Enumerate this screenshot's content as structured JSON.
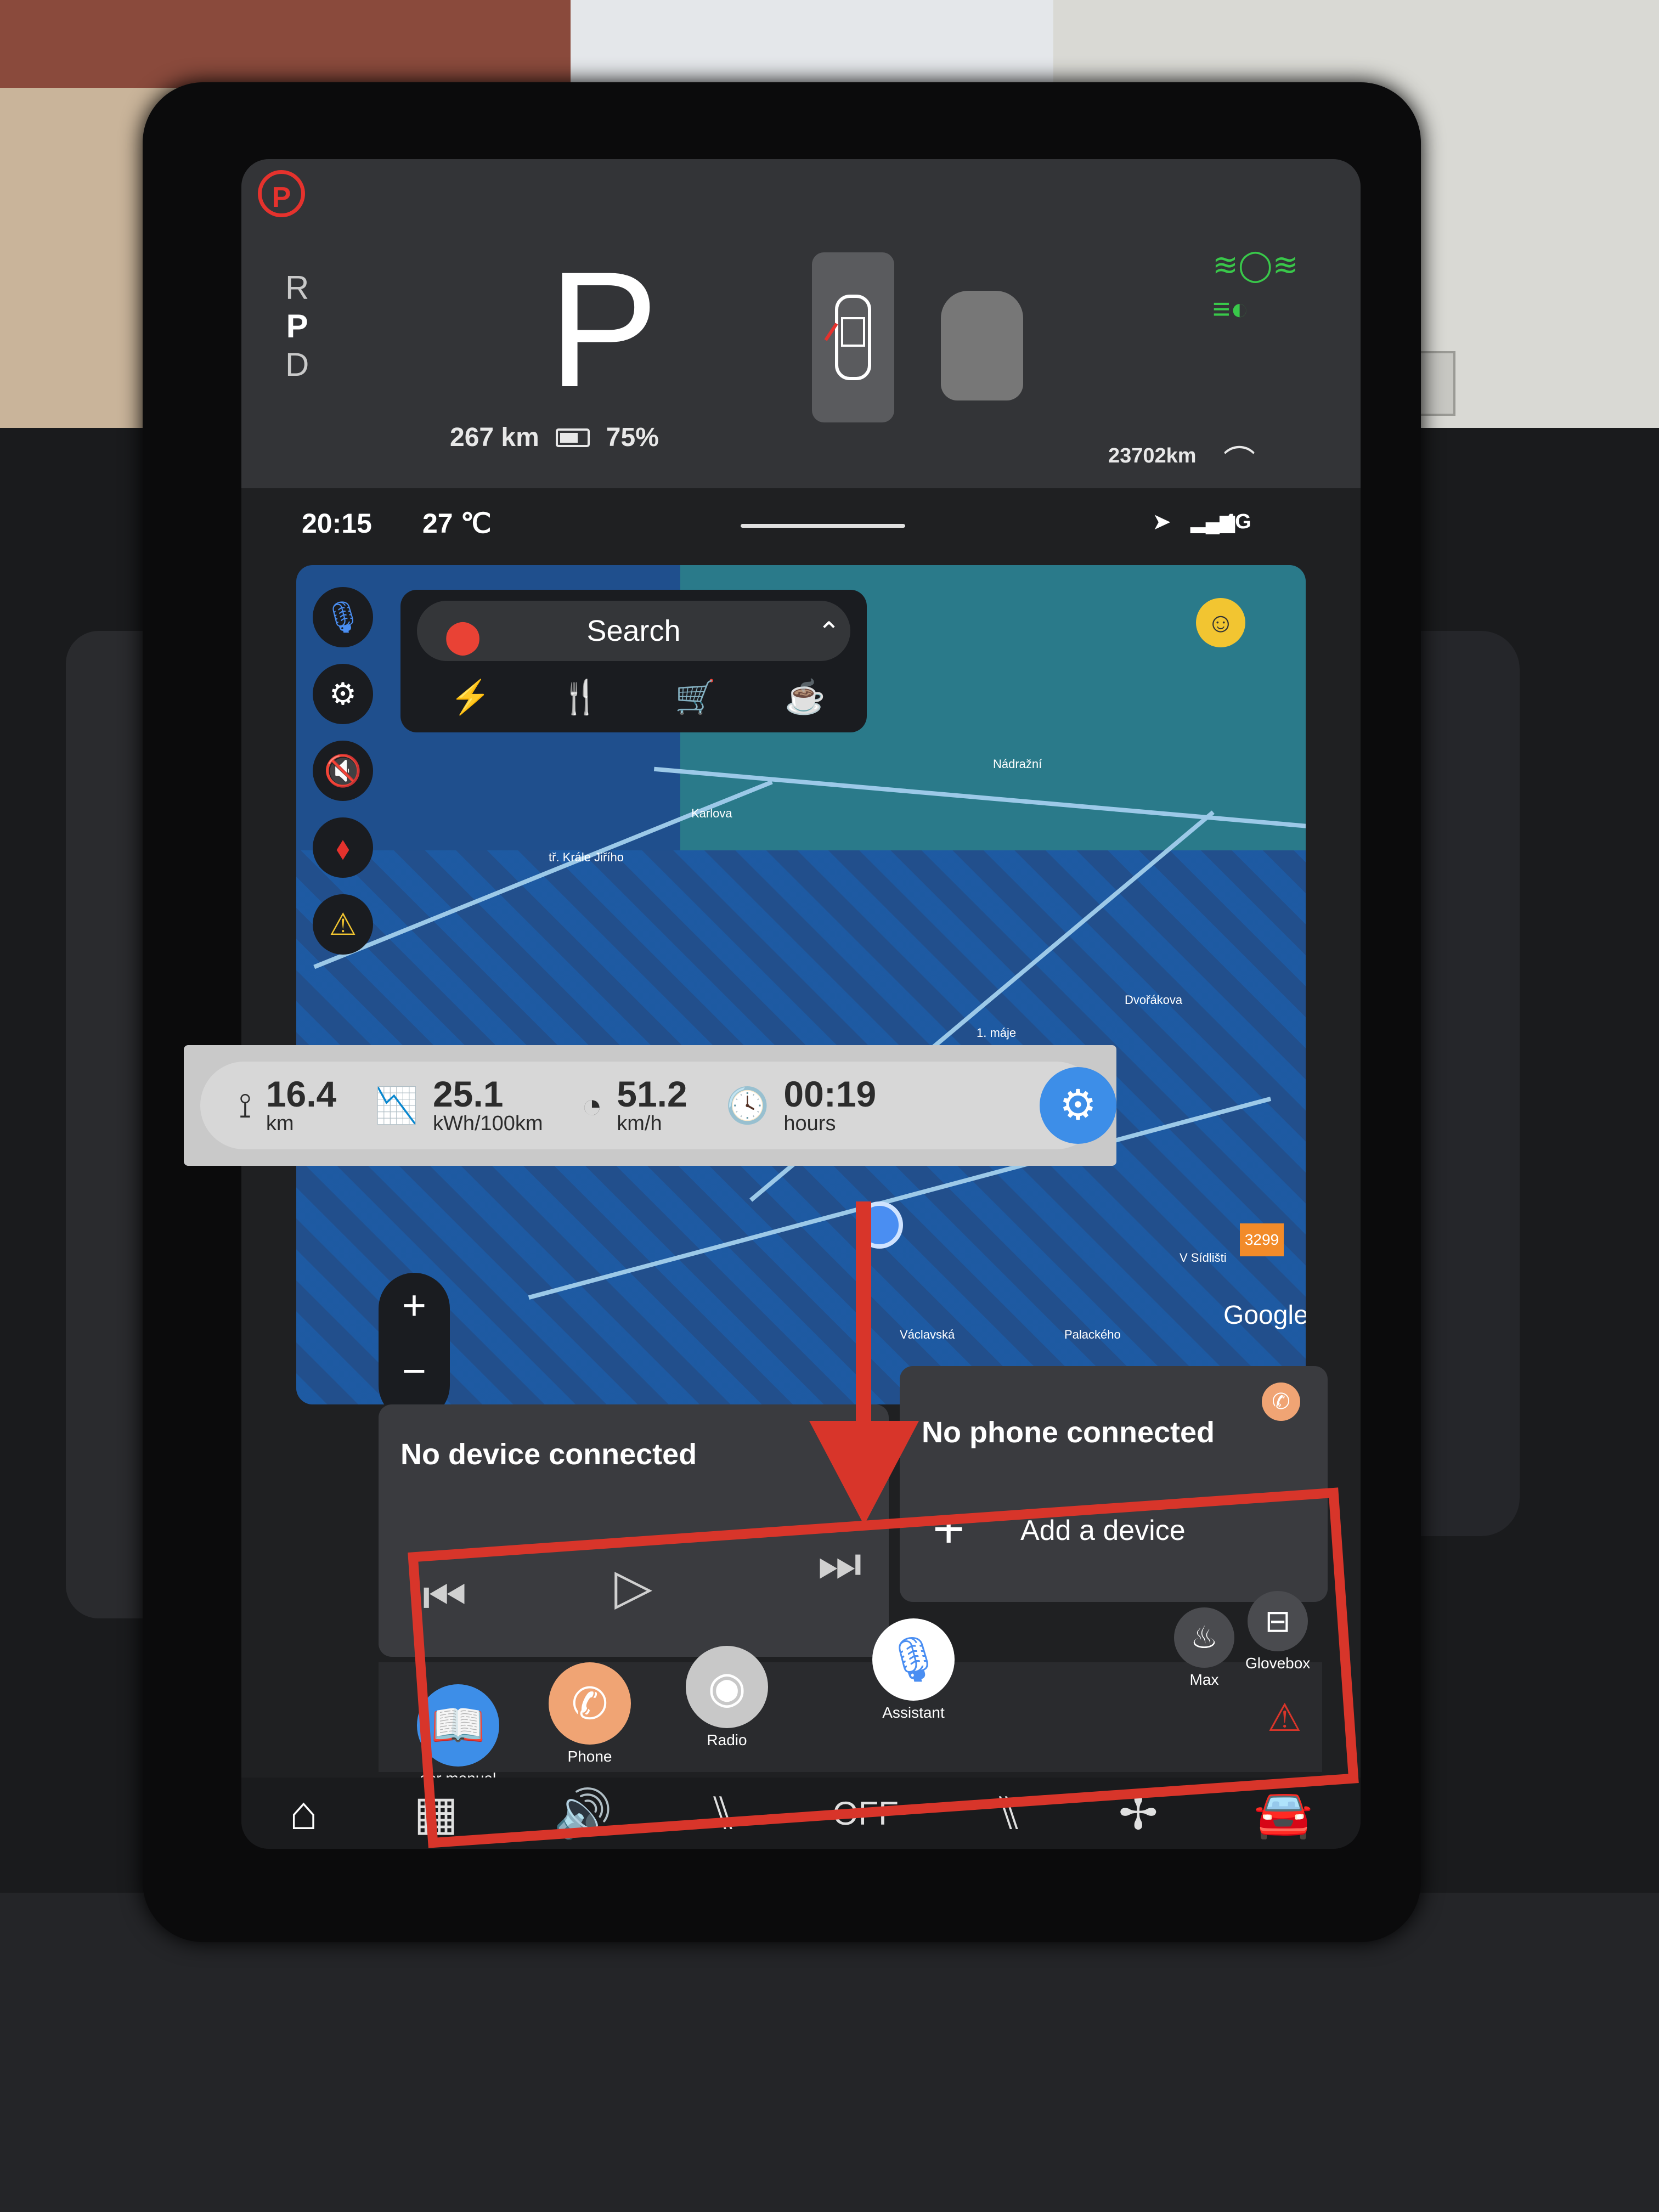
{
  "top": {
    "gears": [
      "R",
      "P",
      "D"
    ],
    "current_gear": "P",
    "range": "267 km",
    "battery": "75%",
    "odometer": "23702km"
  },
  "status": {
    "time": "20:15",
    "temperature": "27 ℃",
    "network": "4G"
  },
  "map": {
    "search_label": "Search",
    "attribution": "Google",
    "route_badge": "3299",
    "streets": [
      "Nádražní",
      "Karlova",
      "Dvořákova",
      "Palackého",
      "1. máje",
      "tř. Krále Jiřího",
      "Václavská",
      "V Sídlišti"
    ]
  },
  "trip": {
    "distance_value": "16.4",
    "distance_unit": "km",
    "consumption_value": "25.1",
    "consumption_unit": "kWh/100km",
    "speed_value": "51.2",
    "speed_unit": "km/h",
    "time_value": "00:19",
    "time_unit": "hours"
  },
  "media": {
    "title": "No device connected"
  },
  "phone": {
    "title": "No phone connected",
    "add_label": "Add a device"
  },
  "dock": {
    "user_manual": "ser manual",
    "phone": "Phone",
    "radio": "Radio",
    "assistant": "Assistant",
    "max": "Max",
    "glovebox": "Glovebox"
  },
  "navbar": {
    "seat_status": "OFF"
  },
  "colors": {
    "accent_blue": "#3d8ee8",
    "phone_orange": "#f0a474",
    "annotation_red": "#d8352a",
    "lamp_green": "#39c84a",
    "brake_red": "#e5322d"
  }
}
